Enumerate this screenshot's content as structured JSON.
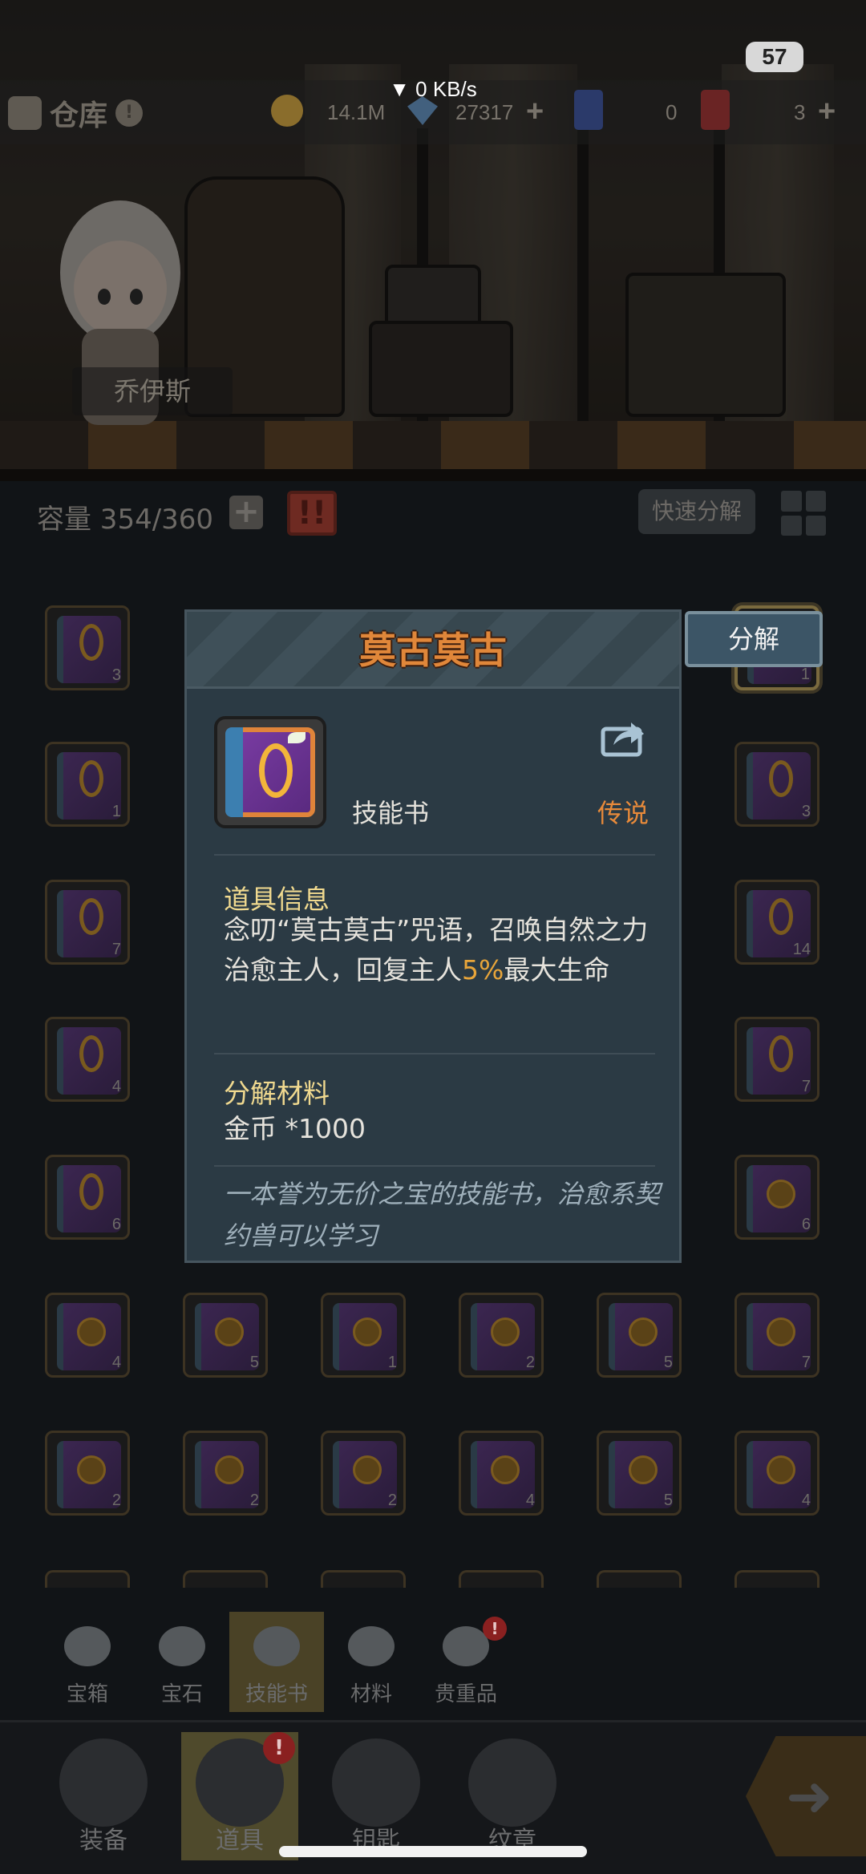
{
  "status_bar": {
    "network": "▼ 0 KB/s",
    "badge": "57"
  },
  "header": {
    "title": "仓库",
    "info_icon_label": "!",
    "gold": "14.1M",
    "diamonds": "27317",
    "card_blue_count": "0",
    "card_red_count": "3"
  },
  "hero": {
    "name": "乔伊斯"
  },
  "capacity": {
    "label": "容量 354/360",
    "alert_label": "!!",
    "quick_decompose": "快速分解"
  },
  "grid": {
    "rows": [
      [
        "3",
        "",
        "",
        "",
        "",
        "1"
      ],
      [
        "1",
        "",
        "",
        "",
        "",
        "3"
      ],
      [
        "7",
        "",
        "",
        "",
        "",
        "14"
      ],
      [
        "4",
        "",
        "",
        "",
        "",
        "7"
      ],
      [
        "6",
        "",
        "",
        "",
        "",
        "6"
      ],
      [
        "4",
        "5",
        "1",
        "2",
        "5",
        "7"
      ],
      [
        "2",
        "2",
        "2",
        "4",
        "5",
        "4"
      ]
    ]
  },
  "popup": {
    "title": "莫古莫古",
    "decompose_button": "分解",
    "item_type": "技能书",
    "rarity": "传说",
    "info_title": "道具信息",
    "info_text_part1": "念叨“莫古莫古”咒语，召唤自然之力治愈主人，回复主人",
    "info_text_highlight": "5%",
    "info_text_part2": "最大生命",
    "materials_title": "分解材料",
    "materials_text": "金币 *1000",
    "flavor_text": "一本誉为无价之宝的技能书，治愈系契约兽可以学习",
    "colors": {
      "title": "#e0873a",
      "rarity": "#e88a3a",
      "highlight": "#e8a53a",
      "section_title": "#f0d98f"
    }
  },
  "tabs": [
    {
      "label": "宝箱",
      "icon": "chest-icon"
    },
    {
      "label": "宝石",
      "icon": "gem-icon"
    },
    {
      "label": "技能书",
      "icon": "book-icon",
      "active": true
    },
    {
      "label": "材料",
      "icon": "material-icon"
    },
    {
      "label": "贵重品",
      "icon": "valuables-icon",
      "badge": "!"
    }
  ],
  "bottom_nav": [
    {
      "label": "装备",
      "icon": "equipment-icon"
    },
    {
      "label": "道具",
      "icon": "items-icon",
      "active": true,
      "badge": "!"
    },
    {
      "label": "钥匙",
      "icon": "key-icon"
    },
    {
      "label": "纹章",
      "icon": "crest-icon"
    }
  ]
}
